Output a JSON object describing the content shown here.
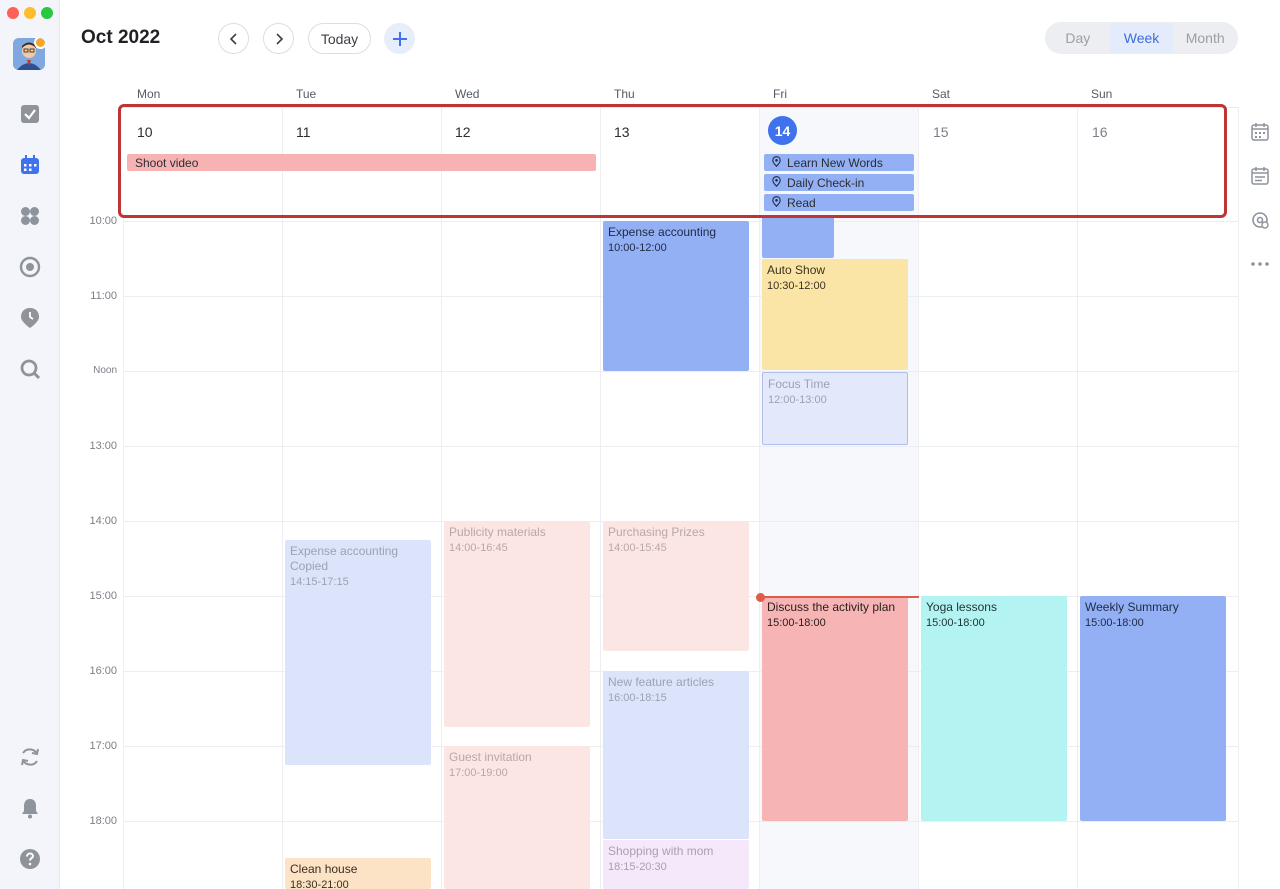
{
  "header": {
    "month_title": "Oct 2022",
    "today_label": "Today",
    "views": [
      {
        "label": "Day",
        "active": false
      },
      {
        "label": "Week",
        "active": true
      },
      {
        "label": "Month",
        "active": false
      }
    ]
  },
  "days": [
    {
      "name": "Mon",
      "num": "10"
    },
    {
      "name": "Tue",
      "num": "11"
    },
    {
      "name": "Wed",
      "num": "12"
    },
    {
      "name": "Thu",
      "num": "13"
    },
    {
      "name": "Fri",
      "num": "14"
    },
    {
      "name": "Sat",
      "num": "15"
    },
    {
      "name": "Sun",
      "num": "16"
    }
  ],
  "allday_events": [
    {
      "title": "Shoot video",
      "color": "#f7b3b3"
    },
    {
      "title": "Learn New Words",
      "color": "#93b0f5"
    },
    {
      "title": "Daily Check-in",
      "color": "#93b0f5"
    },
    {
      "title": "Read",
      "color": "#93b0f5"
    }
  ],
  "time_labels": [
    "10:00",
    "11:00",
    "Noon",
    "13:00",
    "14:00",
    "15:00",
    "16:00",
    "17:00",
    "18:00"
  ],
  "events": [
    {
      "title": "Expense accounting",
      "time": "10:00-12:00",
      "color": "#93b0f5",
      "text": "#1f2a44"
    },
    {
      "title": "Auto Show",
      "time": "10:30-12:00",
      "color": "#fae4a6",
      "text": "#3a3320"
    },
    {
      "title": "Focus Time",
      "time": "12:00-13:00",
      "color": "#e3e9fb",
      "text": "#9aa3b5"
    },
    {
      "title": "Expense accounting Copied",
      "time": "14:15-17:15",
      "color": "#dbe4fb",
      "text": "#9aa3b5"
    },
    {
      "title": "Publicity materials",
      "time": "14:00-16:45",
      "color": "#fce6e4",
      "text": "#b9a7a5"
    },
    {
      "title": "Purchasing Prizes",
      "time": "14:00-15:45",
      "color": "#fce6e4",
      "text": "#b9a7a5"
    },
    {
      "title": "Discuss the activity plan",
      "time": "15:00-18:00",
      "color": "#f6b4b4",
      "text": "#2a2020"
    },
    {
      "title": "Yoga lessons",
      "time": "15:00-18:00",
      "color": "#b3f3f2",
      "text": "#1f3333"
    },
    {
      "title": "Weekly Summary",
      "time": "15:00-18:00",
      "color": "#93b0f5",
      "text": "#1f2a44"
    },
    {
      "title": "New feature articles",
      "time": "16:00-18:15",
      "color": "#dbe4fb",
      "text": "#9aa3b5"
    },
    {
      "title": "Guest invitation",
      "time": "17:00-19:00",
      "color": "#fce6e4",
      "text": "#b9a7a5"
    },
    {
      "title": "Clean house",
      "time": "18:30-21:00",
      "color": "#fde3c6",
      "text": "#3a2e20"
    },
    {
      "title": "Shopping with mom",
      "time": "18:15-20:30",
      "color": "#f5e8fb",
      "text": "#a8a0b0"
    }
  ],
  "sidebar_icons": [
    "avatar",
    "tasks-icon",
    "calendar-icon",
    "apps-icon",
    "focus-icon",
    "pin-clock-icon",
    "search-icon",
    "sync-icon",
    "bell-icon",
    "help-icon"
  ],
  "rail_icons": [
    "calendar-grid-icon",
    "calendar-list-icon",
    "settings-cog-icon",
    "more-icon"
  ]
}
